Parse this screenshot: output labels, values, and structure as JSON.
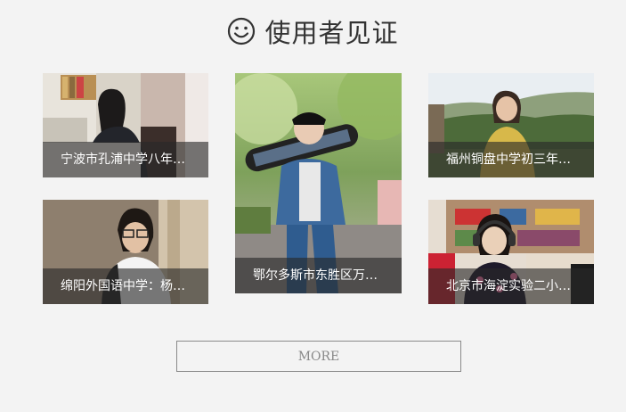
{
  "header": {
    "icon": "smiley-icon",
    "title": "使用者见证"
  },
  "testimonials": [
    {
      "caption": "宁波市孔浦中学八年…"
    },
    {
      "caption": "鄂尔多斯市东胜区万…"
    },
    {
      "caption": "福州铜盘中学初三年…"
    },
    {
      "caption": "绵阳外国语中学：杨…"
    },
    {
      "caption": "北京市海淀实验二小…"
    }
  ],
  "more_button": {
    "label": "MORE"
  },
  "colors": {
    "background": "#f3f3f3",
    "caption_overlay": "rgba(40,40,40,0.62)",
    "title_text": "#333333",
    "button_border": "#8a8a8a"
  }
}
